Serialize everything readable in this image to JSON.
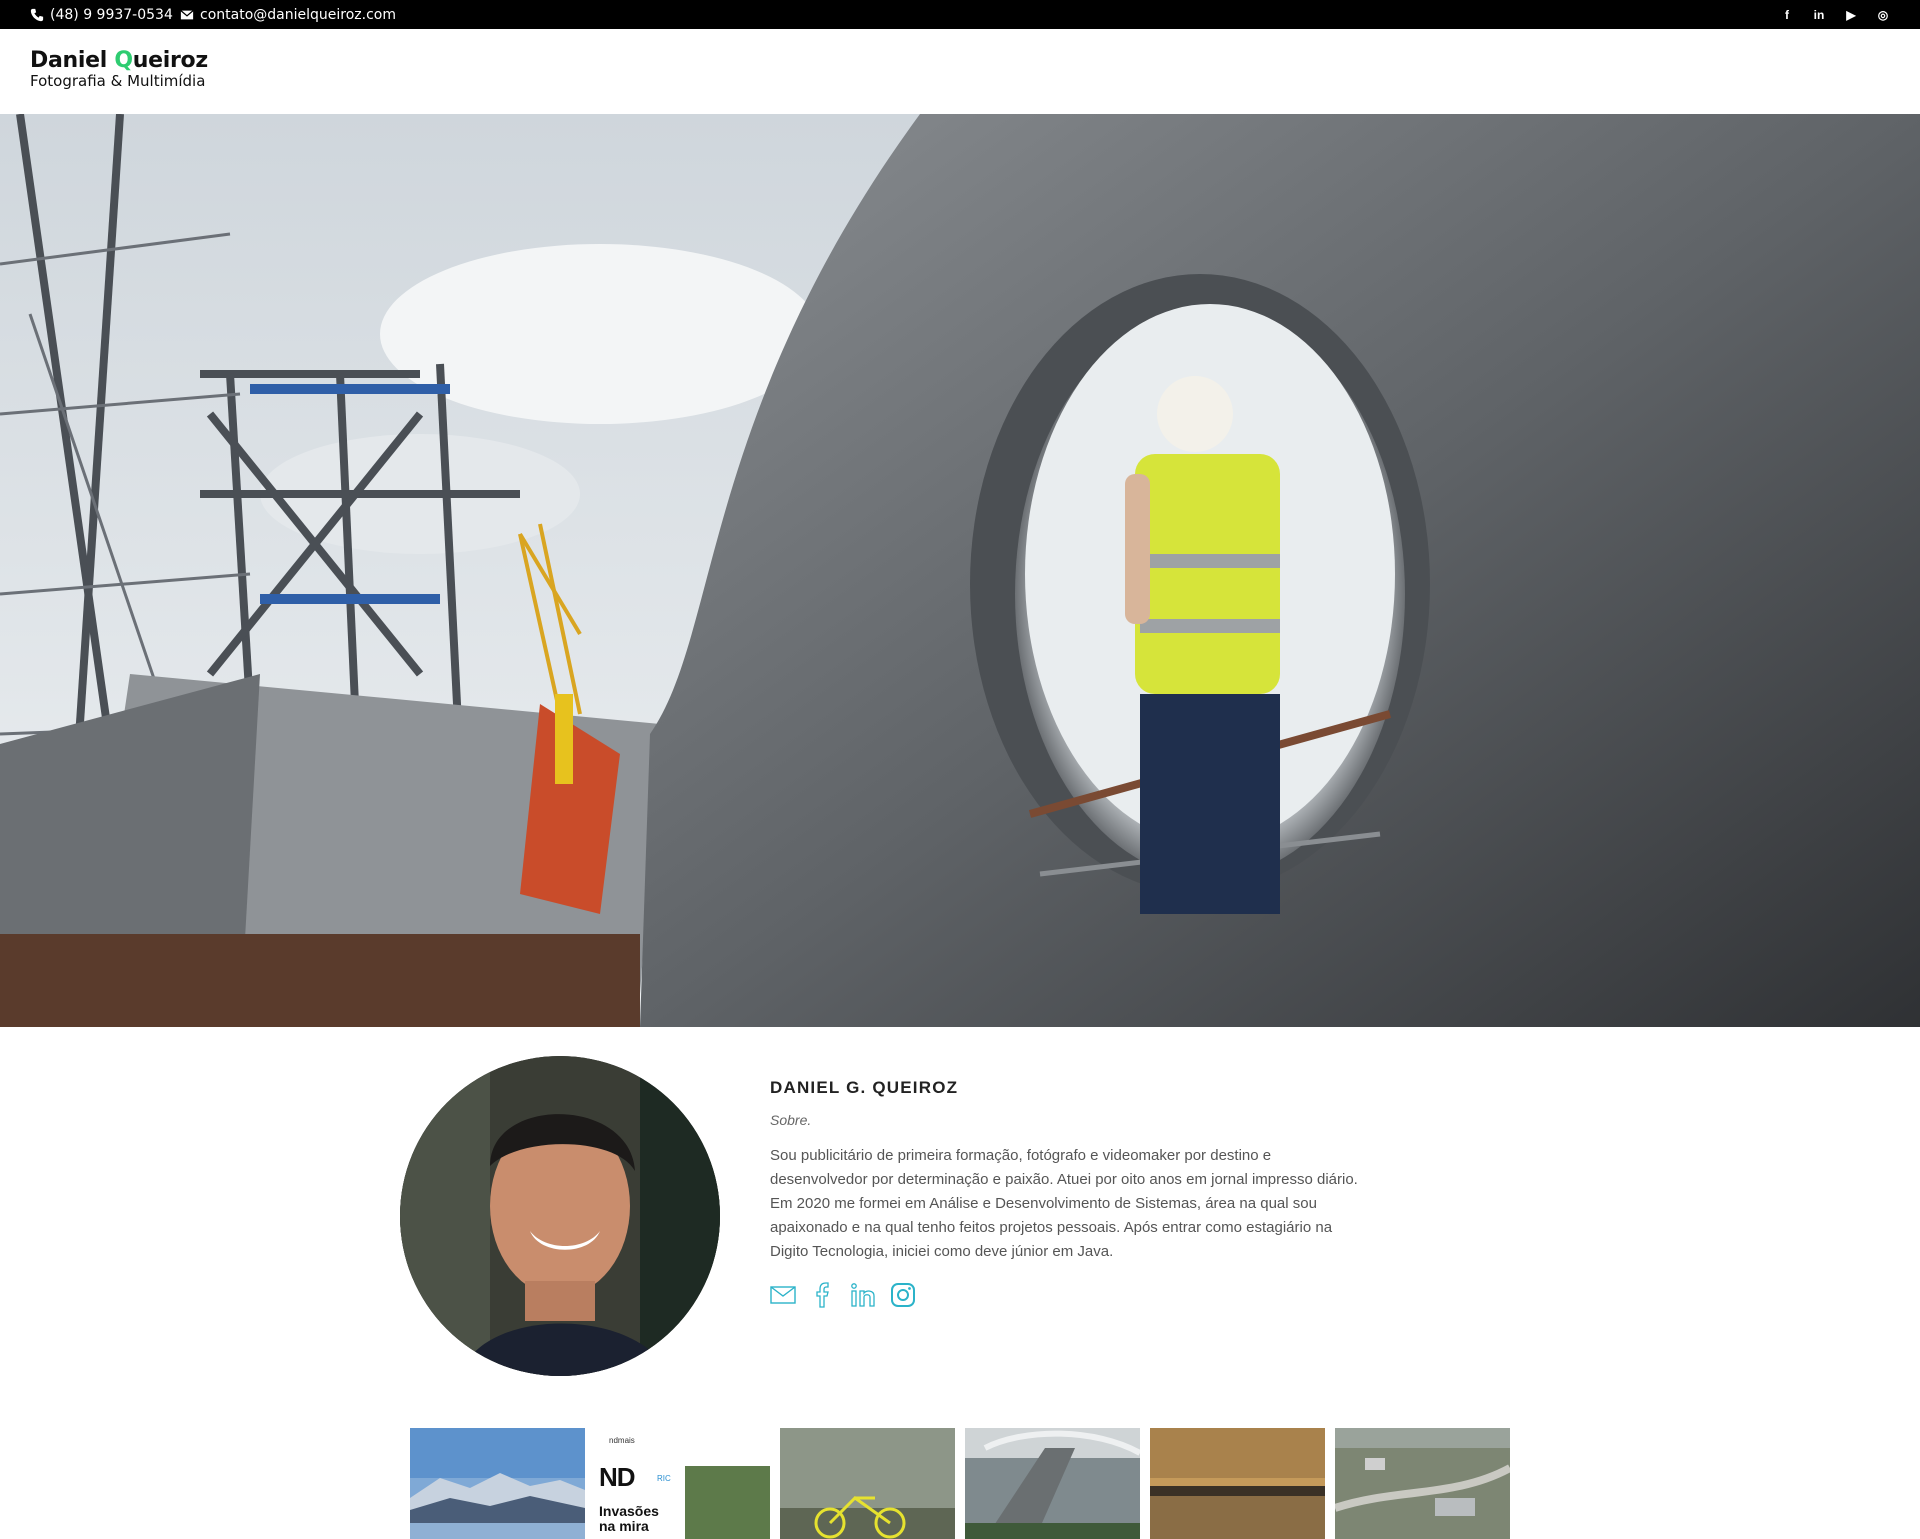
{
  "topbar": {
    "phone": "(48) 9 9937-0534",
    "email": "contato@danielqueiroz.com",
    "social": [
      {
        "icon": "facebook-icon",
        "glyph": "f"
      },
      {
        "icon": "linkedin-icon",
        "glyph": "in"
      },
      {
        "icon": "youtube-icon",
        "glyph": "▶"
      },
      {
        "icon": "instagram-icon",
        "glyph": "◎"
      }
    ]
  },
  "header": {
    "logo_first": "Daniel ",
    "logo_q": "Q",
    "logo_rest": "ueiroz",
    "logo_tagline": "Fotografia & Multimídia"
  },
  "about": {
    "name": "DANIEL G. QUEIROZ",
    "subtitle": "Sobre.",
    "bio": "Sou publicitário de primeira formação, fotógrafo e videomaker por destino e desenvolvedor por determinação e paixão. Atuei por oito anos em jornal impresso diário. Em 2020 me formei em Análise e Desenvolvimento de Sistemas, área na qual sou apaixonado e na qual tenho feitos projetos pessoais. Após entrar como estagiário na Digito Tecnologia, iniciei como deve júnior em Java.",
    "links": [
      "mail-icon",
      "facebook-icon",
      "linkedin-icon",
      "instagram-icon"
    ]
  },
  "gallery": {
    "newspaper_brand": "ndmais",
    "newspaper_logo": "ND",
    "newspaper_sub": "RIC",
    "newspaper_headline_1": "Invasões",
    "newspaper_headline_2": "na mira"
  },
  "colors": {
    "accent": "#2ecc71",
    "icon_teal": "#2bb3c9",
    "topbar_bg": "#000000"
  }
}
